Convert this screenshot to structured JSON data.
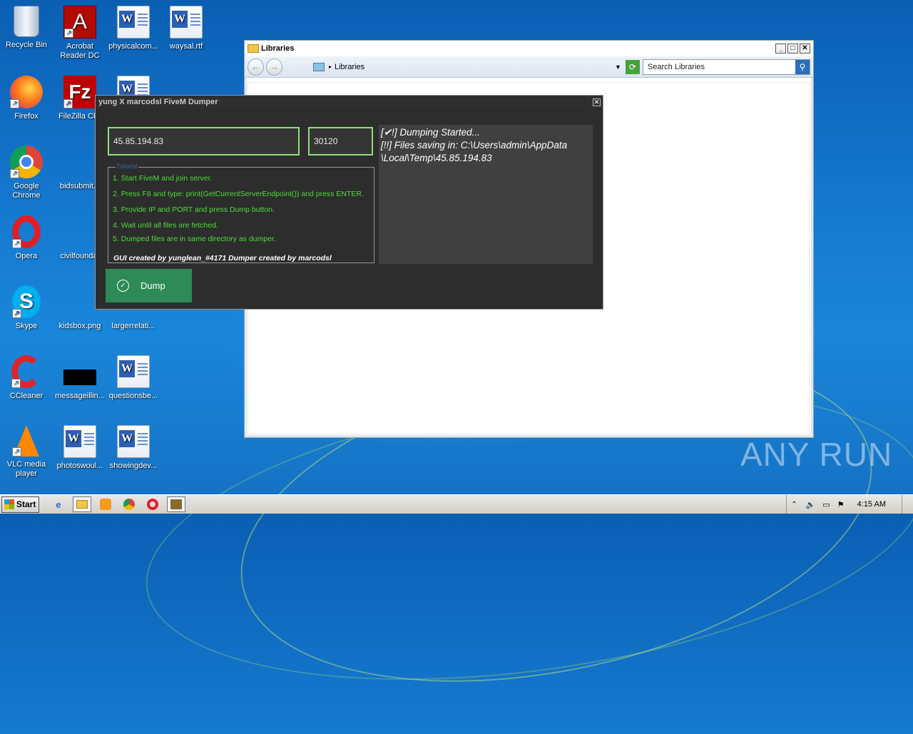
{
  "desktop": {
    "icons": [
      {
        "label": "Recycle Bin",
        "icon": "recycle-bin-icon"
      },
      {
        "label": "Acrobat\nReader DC",
        "icon": "acrobat-icon"
      },
      {
        "label": "physicalcom...",
        "icon": "word-doc-icon"
      },
      {
        "label": "waysal.rtf",
        "icon": "word-doc-icon"
      },
      {
        "label": "Firefox",
        "icon": "firefox-icon"
      },
      {
        "label": "FileZilla Clie",
        "icon": "filezilla-icon"
      },
      {
        "label": "Google\nChrome",
        "icon": "chrome-icon"
      },
      {
        "label": "bidsubmit.p",
        "icon": "file-icon"
      },
      {
        "label": "Opera",
        "icon": "opera-icon"
      },
      {
        "label": "civilfoundat",
        "icon": "file-icon"
      },
      {
        "label": "Skype",
        "icon": "skype-icon"
      },
      {
        "label": "kidsbox.png",
        "icon": "image-icon"
      },
      {
        "label": "largerrelati...",
        "icon": "word-doc-icon"
      },
      {
        "label": "CCleaner",
        "icon": "ccleaner-icon"
      },
      {
        "label": "messageillin...",
        "icon": "image-icon"
      },
      {
        "label": "questionsbe...",
        "icon": "word-doc-icon"
      },
      {
        "label": "VLC media\nplayer",
        "icon": "vlc-icon"
      },
      {
        "label": "photoswoul...",
        "icon": "word-doc-icon"
      },
      {
        "label": "showingdev...",
        "icon": "word-doc-icon"
      }
    ],
    "watermark": "ANY RUN"
  },
  "explorer": {
    "title": "Libraries",
    "address": "Libraries",
    "search_placeholder": "Search Libraries"
  },
  "dumper": {
    "title": "yung X marcodsl FiveM Dumper",
    "ip_value": "45.85.194.83",
    "port_value": "30120",
    "tutorial_label": "Tutorial",
    "steps": [
      "1. Start FiveM and join server.",
      "2. Press F8 and type: print(GetCurrentServerEndpoint()) and press ENTER.",
      "3. Provide IP and PORT and press Dump button.",
      "4. Wait until all files are fetched.",
      "5. Dumped files are in same directory as dumper."
    ],
    "credit": "GUI created by yunglean_#4171 Dumper created by marcodsl",
    "log_lines": [
      "[✔!] Dumping Started...",
      "[!!] Files saving in: C:\\Users\\admin\\AppData",
      "\\Local\\Temp\\45.85.194.83"
    ],
    "dump_label": "Dump"
  },
  "taskbar": {
    "start_label": "Start",
    "clock": "4:15 AM"
  }
}
